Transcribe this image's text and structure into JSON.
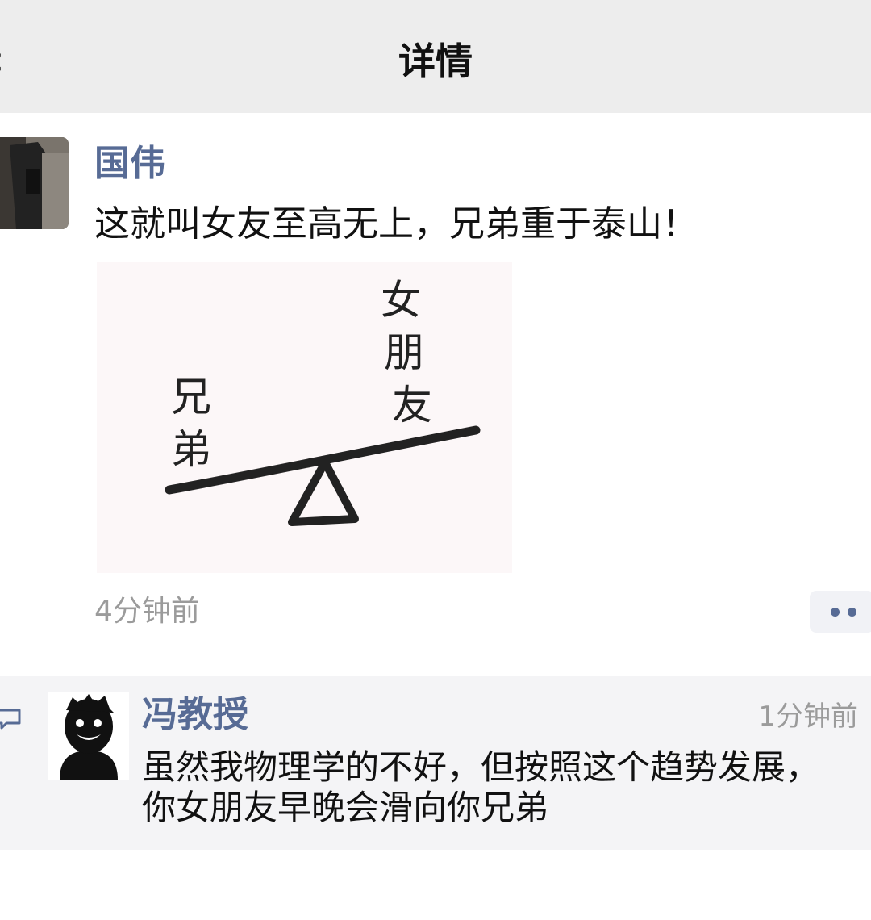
{
  "header": {
    "title": "详情",
    "back_icon": "chevron-left-icon"
  },
  "post": {
    "author": "国伟",
    "text": "这就叫女友至高无上，兄弟重于泰山！",
    "image": {
      "label_left": [
        "兄",
        "弟"
      ],
      "label_right": [
        "女",
        "朋",
        "友"
      ]
    },
    "time": "4分钟前",
    "more_icon": "ellipsis-icon"
  },
  "comment": {
    "author": "冯教授",
    "time": "1分钟前",
    "lines": [
      "虽然我物理学的不好，但按照这个趋势发展，",
      "你女朋友早晚会滑向你兄弟"
    ]
  },
  "colors": {
    "link": "#576b95",
    "header_bg": "#ededed",
    "comment_bg": "#f4f4f6",
    "muted": "#9b9b9b"
  }
}
